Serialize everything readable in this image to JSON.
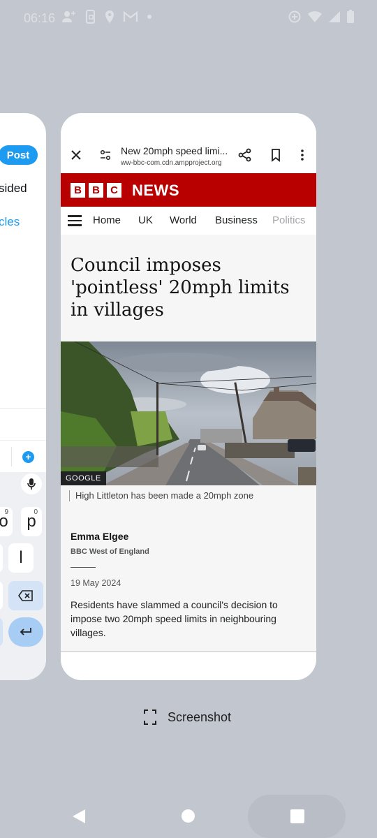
{
  "status_bar": {
    "time": "06:16",
    "left_icons": [
      "person-add-icon",
      "phone-sync-icon",
      "location-icon",
      "gmail-icon",
      "dot-icon"
    ],
    "right_icons": [
      "data-saver-icon",
      "wifi-icon",
      "signal-icon",
      "battery-icon"
    ]
  },
  "left_card": {
    "post_button": "Post",
    "text_fragment_1": "sided",
    "text_fragment_2": "cles",
    "keyboard": {
      "key_o": "o",
      "key_o_alt": "9",
      "key_p": "p",
      "key_p_alt": "0",
      "key_l": "l"
    },
    "accent_color": "#1d9bf0"
  },
  "browser": {
    "page_title": "New 20mph speed limi...",
    "url": "ww-bbc-com.cdn.ampproject.org"
  },
  "bbc": {
    "logo_letters": [
      "B",
      "B",
      "C"
    ],
    "logo_news": "NEWS",
    "brand_color": "#b80000",
    "nav_items": [
      "Home",
      "UK",
      "World",
      "Business",
      "Politics"
    ]
  },
  "article": {
    "headline": "Council imposes 'pointless' 20mph limits in villages",
    "photo_credit": "GOOGLE",
    "caption": "High Littleton has been made a 20mph zone",
    "author": "Emma Elgee",
    "organisation": "BBC West of England",
    "date": "19 May 2024",
    "summary": "Residents have slammed a council's decision to impose two 20mph speed limits in neighbouring villages."
  },
  "recents": {
    "screenshot_label": "Screenshot"
  }
}
